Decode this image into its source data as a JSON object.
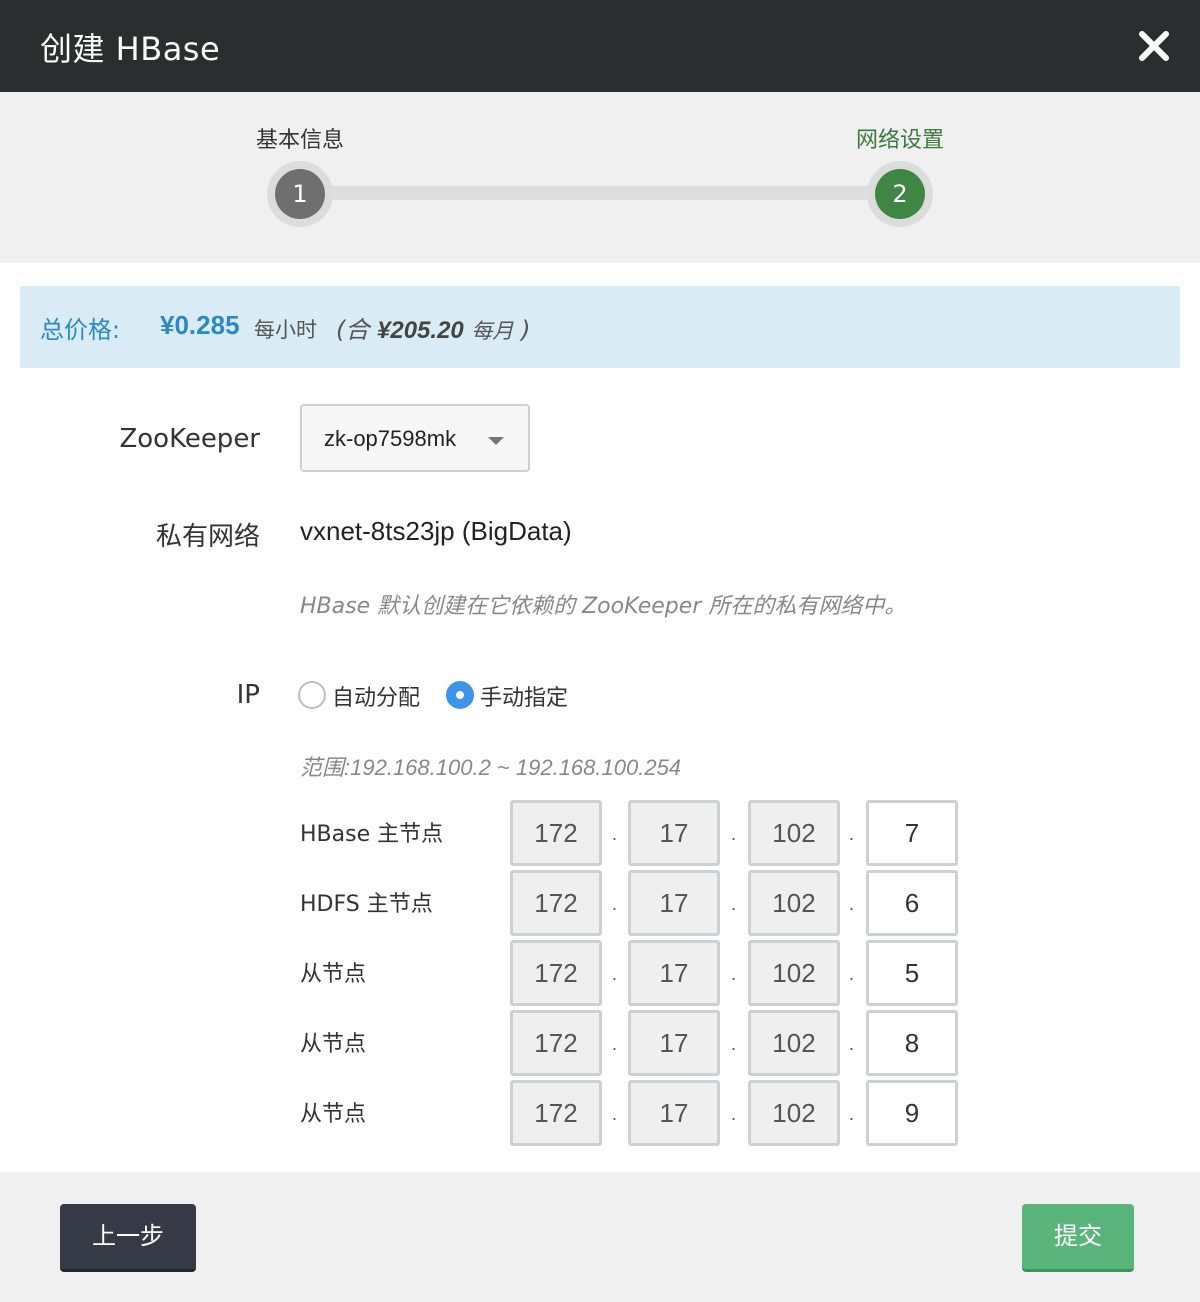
{
  "dialog": {
    "title": "创建 HBase",
    "close_icon": "close-icon"
  },
  "steps": [
    {
      "label": "基本信息",
      "number": "1",
      "state": "done"
    },
    {
      "label": "网络设置",
      "number": "2",
      "state": "active"
    }
  ],
  "price": {
    "label": "总价格:",
    "hourly": "¥0.285",
    "hourly_unit": "每小时",
    "monthly_prefix": "(合",
    "monthly": "¥205.20",
    "monthly_unit": "每月",
    "monthly_suffix": ")"
  },
  "zookeeper": {
    "label": "ZooKeeper",
    "selected": "zk-op7598mk"
  },
  "network": {
    "label": "私有网络",
    "value": "vxnet-8ts23jp (BigData)",
    "hint": "HBase 默认创建在它依赖的 ZooKeeper 所在的私有网络中。"
  },
  "ip": {
    "label": "IP",
    "options": [
      {
        "label": "自动分配",
        "selected": false
      },
      {
        "label": "手动指定",
        "selected": true
      }
    ],
    "range": "范围:192.168.100.2 ~ 192.168.100.254",
    "nodes": [
      {
        "name": "HBase 主节点",
        "octets": [
          "172",
          "17",
          "102",
          "7"
        ]
      },
      {
        "name": "HDFS 主节点",
        "octets": [
          "172",
          "17",
          "102",
          "6"
        ]
      },
      {
        "name": "从节点",
        "octets": [
          "172",
          "17",
          "102",
          "5"
        ]
      },
      {
        "name": "从节点",
        "octets": [
          "172",
          "17",
          "102",
          "8"
        ]
      },
      {
        "name": "从节点",
        "octets": [
          "172",
          "17",
          "102",
          "9"
        ]
      }
    ],
    "separator": "."
  },
  "footer": {
    "prev_label": "上一步",
    "submit_label": "提交"
  },
  "colors": {
    "titlebar": "#2b2d2f",
    "active_step": "#3f8644",
    "price_text": "#2b8ac4",
    "radio_on": "#3c95e8",
    "submit": "#59b57c",
    "prev": "#363a46"
  }
}
